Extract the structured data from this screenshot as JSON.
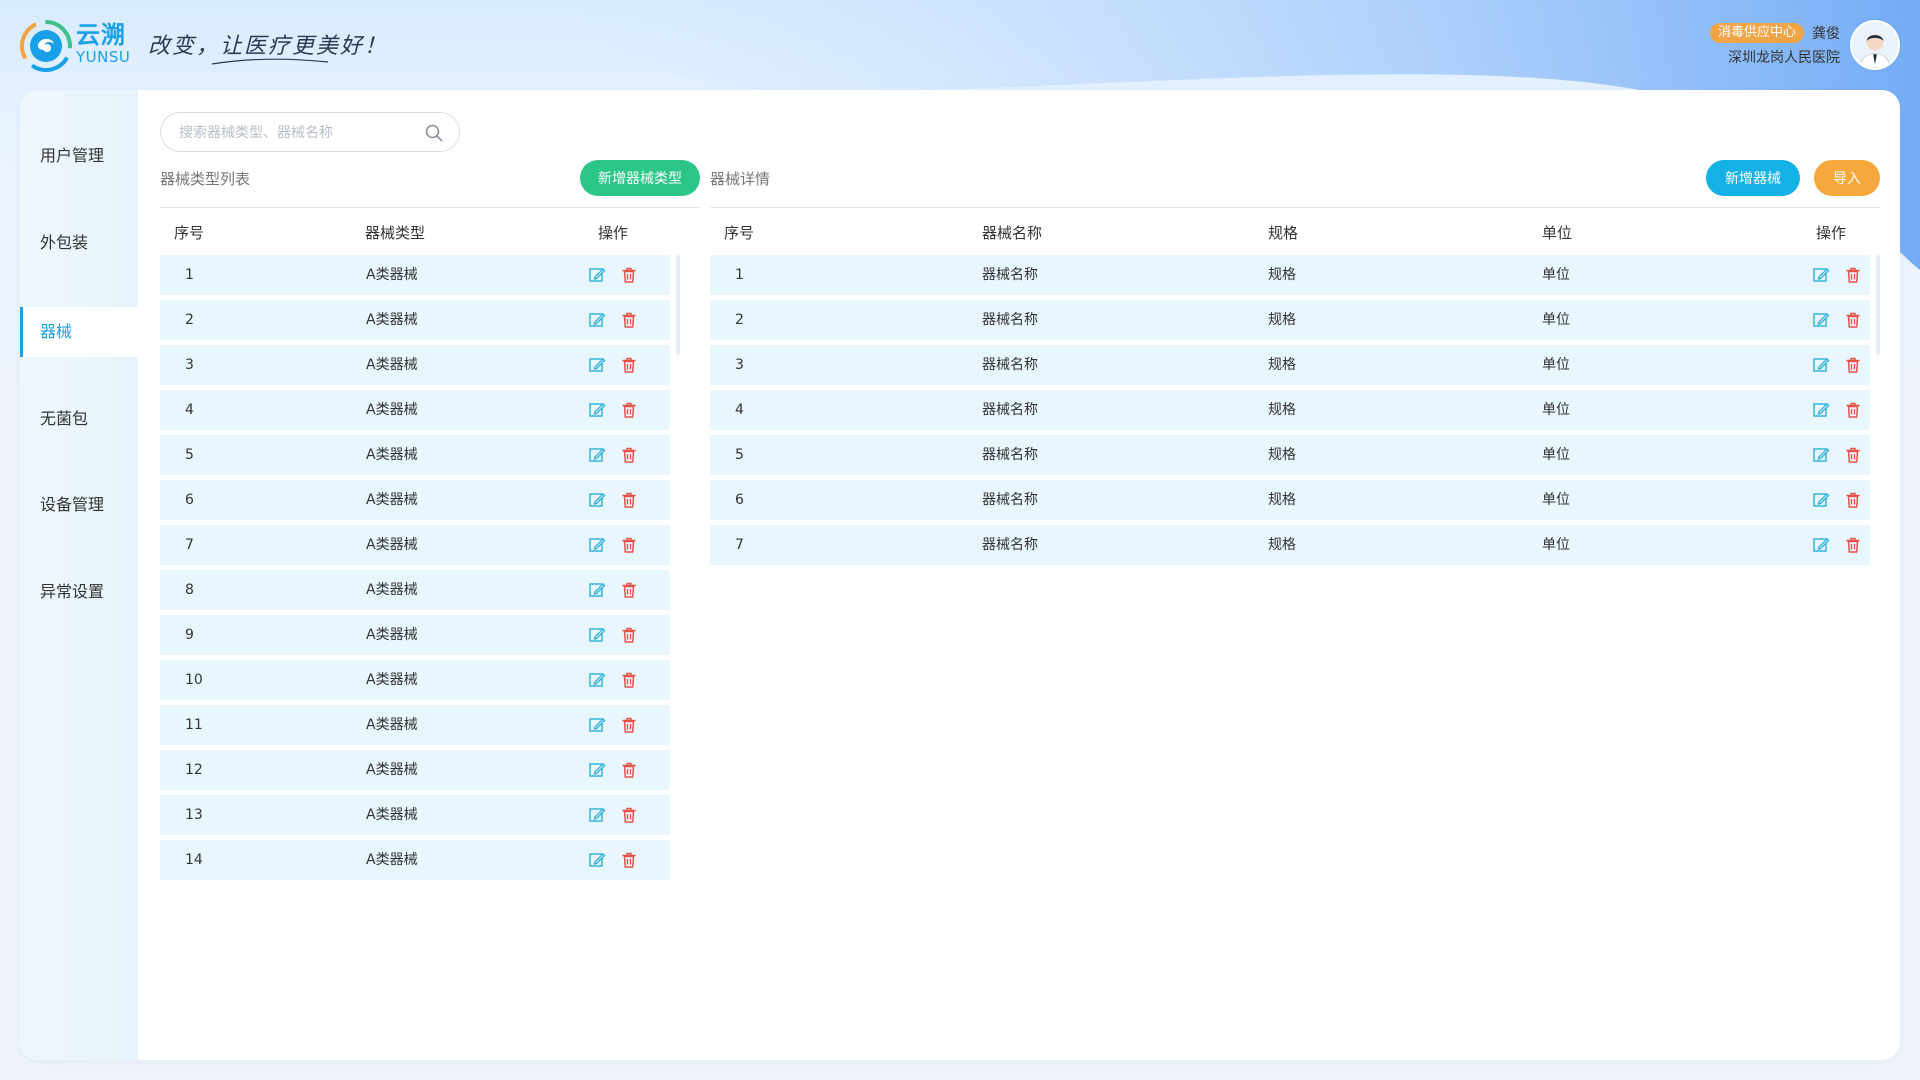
{
  "header": {
    "brand_cn": "云溯",
    "brand_en": "YUNSU",
    "slogan": "改变，让医疗更美好！",
    "department_badge": "消毒供应中心",
    "user_name": "龚俊",
    "hospital": "深圳龙岗人民医院"
  },
  "sidebar": {
    "items": [
      {
        "label": "用户管理",
        "active": false
      },
      {
        "label": "外包装",
        "active": false
      },
      {
        "label": "器械",
        "active": true
      },
      {
        "label": "无菌包",
        "active": false
      },
      {
        "label": "设备管理",
        "active": false
      },
      {
        "label": "异常设置",
        "active": false
      }
    ]
  },
  "search": {
    "placeholder": "搜索器械类型、器械名称",
    "value": ""
  },
  "type_list": {
    "title": "器械类型列表",
    "add_button": "新增器械类型",
    "columns": [
      "序号",
      "器械类型",
      "操作"
    ],
    "rows": [
      {
        "no": "1",
        "type": "A类器械"
      },
      {
        "no": "2",
        "type": "A类器械"
      },
      {
        "no": "3",
        "type": "A类器械"
      },
      {
        "no": "4",
        "type": "A类器械"
      },
      {
        "no": "5",
        "type": "A类器械"
      },
      {
        "no": "6",
        "type": "A类器械"
      },
      {
        "no": "7",
        "type": "A类器械"
      },
      {
        "no": "8",
        "type": "A类器械"
      },
      {
        "no": "9",
        "type": "A类器械"
      },
      {
        "no": "10",
        "type": "A类器械"
      },
      {
        "no": "11",
        "type": "A类器械"
      },
      {
        "no": "12",
        "type": "A类器械"
      },
      {
        "no": "13",
        "type": "A类器械"
      },
      {
        "no": "14",
        "type": "A类器械"
      }
    ]
  },
  "detail": {
    "title": "器械详情",
    "add_button": "新增器械",
    "import_button": "导入",
    "columns": [
      "序号",
      "器械名称",
      "规格",
      "单位",
      "操作"
    ],
    "rows": [
      {
        "no": "1",
        "name": "器械名称",
        "spec": "规格",
        "unit": "单位"
      },
      {
        "no": "2",
        "name": "器械名称",
        "spec": "规格",
        "unit": "单位"
      },
      {
        "no": "3",
        "name": "器械名称",
        "spec": "规格",
        "unit": "单位"
      },
      {
        "no": "4",
        "name": "器械名称",
        "spec": "规格",
        "unit": "单位"
      },
      {
        "no": "5",
        "name": "器械名称",
        "spec": "规格",
        "unit": "单位"
      },
      {
        "no": "6",
        "name": "器械名称",
        "spec": "规格",
        "unit": "单位"
      },
      {
        "no": "7",
        "name": "器械名称",
        "spec": "规格",
        "unit": "单位"
      }
    ]
  },
  "icons": {
    "edit": "edit-icon",
    "delete": "delete-icon",
    "search": "search-icon"
  },
  "colors": {
    "accent": "#1aa0e6",
    "edit_icon": "#2bb0d8",
    "delete_icon": "#e5534b",
    "row_bg": "#e8f6fd",
    "green_button": "#2cc689",
    "blue_button": "#14b1e6",
    "orange_button": "#f5a93c",
    "badge": "#f0a445"
  }
}
